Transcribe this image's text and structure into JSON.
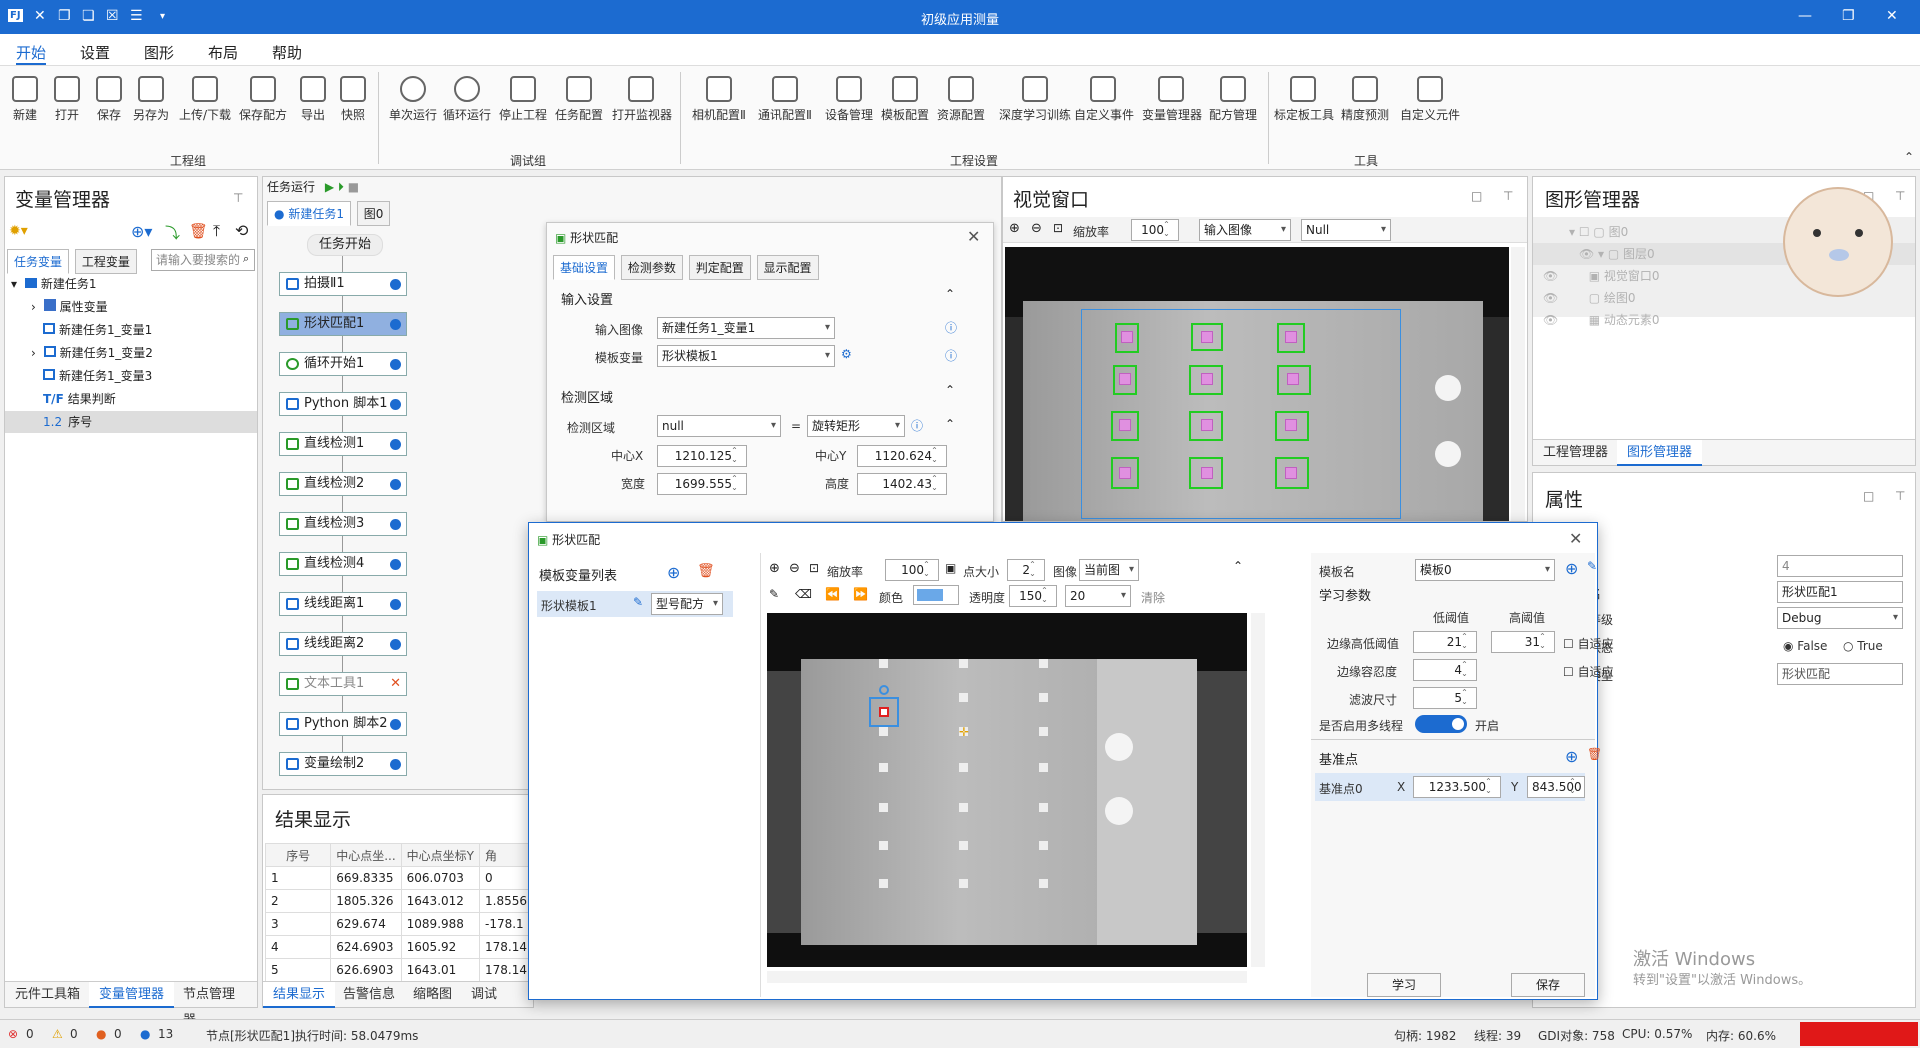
{
  "app": {
    "title": "初级应用测量",
    "quick_icons": [
      "app-logo-icon",
      "tool-icon",
      "copy-icon",
      "paste-icon",
      "checkbox-icon",
      "list-icon",
      "dropdown-icon"
    ]
  },
  "menu": [
    "开始",
    "设置",
    "图形",
    "布局",
    "帮助"
  ],
  "ribbon": {
    "buttons": [
      {
        "label": "新建",
        "icon": "new-file-icon"
      },
      {
        "label": "打开",
        "icon": "folder-open-icon"
      },
      {
        "label": "保存",
        "icon": "save-icon"
      },
      {
        "label": "另存为",
        "icon": "save-as-icon"
      },
      {
        "label": "上传/下载",
        "icon": "cloud-upload-icon"
      },
      {
        "label": "保存配方",
        "icon": "recipe-save-icon"
      },
      {
        "label": "导出",
        "icon": "export-icon"
      },
      {
        "label": "快照",
        "icon": "snapshot-icon"
      },
      {
        "label": "单次运行",
        "icon": "play-once-icon"
      },
      {
        "label": "循环运行",
        "icon": "loop-run-icon"
      },
      {
        "label": "停止工程",
        "icon": "stop-icon"
      },
      {
        "label": "任务配置",
        "icon": "task-config-icon"
      },
      {
        "label": "打开监视器",
        "icon": "monitor-icon"
      },
      {
        "label": "相机配置Ⅱ",
        "icon": "camera-icon"
      },
      {
        "label": "通讯配置Ⅱ",
        "icon": "network-icon"
      },
      {
        "label": "设备管理",
        "icon": "device-icon"
      },
      {
        "label": "模板配置",
        "icon": "template-icon"
      },
      {
        "label": "资源配置",
        "icon": "resource-icon"
      },
      {
        "label": "深度学习训练",
        "icon": "deep-learning-icon"
      },
      {
        "label": "自定义事件",
        "icon": "event-gear-icon"
      },
      {
        "label": "变量管理器",
        "icon": "fx-icon"
      },
      {
        "label": "配方管理",
        "icon": "recipe-grid-icon"
      },
      {
        "label": "标定板工具",
        "icon": "calibration-icon"
      },
      {
        "label": "精度预测",
        "icon": "precision-icon"
      },
      {
        "label": "自定义元件",
        "icon": "custom-component-icon"
      }
    ],
    "groups": [
      "工程组",
      "调试组",
      "工程设置",
      "工具"
    ]
  },
  "var_manager": {
    "title": "变量管理器",
    "tabs": [
      "任务变量",
      "工程变量"
    ],
    "search_placeholder": "请输入要搜索的",
    "tree": [
      "新建任务1",
      "属性变量",
      "新建任务1_变量1",
      "新建任务1_变量2",
      "新建任务1_变量3",
      "结果判断",
      "序号"
    ],
    "bottom_tabs": [
      "元件工具箱",
      "变量管理器",
      "节点管理器"
    ]
  },
  "flow": {
    "run_label": "任务运行",
    "tabs": [
      "新建任务1",
      "图0"
    ],
    "start": "任务开始",
    "nodes": [
      "拍摄Ⅱ1",
      "形状匹配1",
      "循环开始1",
      "Python 脚本1",
      "直线检测1",
      "直线检测2",
      "直线检测3",
      "直线检测4",
      "线线距离1",
      "线线距离2",
      "文本工具1",
      "Python 脚本2",
      "变量绘制2"
    ]
  },
  "results": {
    "title": "结果显示",
    "headers": [
      "序号",
      "中心点坐...",
      "中心点坐标Y",
      "角"
    ],
    "rows": [
      [
        "1",
        "669.8335",
        "606.0703",
        "0"
      ],
      [
        "2",
        "1805.326",
        "1643.012",
        "1.8556"
      ],
      [
        "3",
        "629.674",
        "1089.988",
        "-178.1"
      ],
      [
        "4",
        "624.6903",
        "1605.92",
        "178.14"
      ],
      [
        "5",
        "626.6903",
        "1643.01",
        "178.14"
      ]
    ],
    "bottom_tabs": [
      "结果显示",
      "告警信息",
      "缩略图",
      "调试"
    ]
  },
  "shape_cfg": {
    "title": "形状匹配",
    "tabs": [
      "基础设置",
      "检测参数",
      "判定配置",
      "显示配置"
    ],
    "input_section": "输入设置",
    "input_image_label": "输入图像",
    "input_image": "新建任务1_变量1",
    "template_var_label": "模板变量",
    "template_var": "形状模板1",
    "region_section": "检测区域",
    "region_label": "检测区域",
    "region_value": "null",
    "region_eq": "=",
    "region_shape": "旋转矩形",
    "cx_label": "中心X",
    "cx": "1210.125",
    "cy_label": "中心Y",
    "cy": "1120.624",
    "w_label": "宽度",
    "w": "1699.555",
    "h_label": "高度",
    "h": "1402.43"
  },
  "vision": {
    "title": "视觉窗口",
    "zoom_label": "缩放率",
    "zoom": "100",
    "source": "输入图像",
    "mode": "Null"
  },
  "graphic_manager": {
    "title": "图形管理器",
    "tree": [
      "图0",
      "图层0",
      "视觉窗口0",
      "绘图0",
      "动态元素0"
    ],
    "tabs": [
      "工程管理器",
      "图形管理器"
    ]
  },
  "properties": {
    "title": "属性",
    "name_label": "名",
    "level_label": "等级",
    "state_label": "状态",
    "type_label": "类型",
    "value_4": "4",
    "name": "形状匹配1",
    "level": "Debug",
    "false_label": "False",
    "true_label": "True",
    "type": "形状匹配"
  },
  "dialog": {
    "title": "形状匹配",
    "list_title": "模板变量列表",
    "template_item": "形状模板1",
    "template_recipe": "型号配方",
    "zoom_label": "缩放率",
    "zoom": "100",
    "point_label": "点大小",
    "point": "2",
    "image_label": "图像",
    "image": "当前图",
    "color_label": "颜色",
    "alpha_label": "透明度",
    "alpha": "150",
    "size": "20",
    "clear": "清除",
    "tpl_name_label": "模板名",
    "tpl_name": "模板0",
    "learn_section": "学习参数",
    "low_label": "低阈值",
    "high_label": "高阈值",
    "edge_label": "边缘高低阈值",
    "edge_low": "21",
    "edge_high": "31",
    "auto1": "自适应",
    "tol_label": "边缘容忍度",
    "tol": "4",
    "auto2": "自适应",
    "filter_label": "滤波尺寸",
    "filter": "5",
    "mt_label": "是否启用多线程",
    "mt_state": "开启",
    "base_section": "基准点",
    "base_name": "基准点0",
    "x_label": "X",
    "x": "1233.500",
    "y_label": "Y",
    "y": "843.500",
    "learn_btn": "学习",
    "save_btn": "保存"
  },
  "status": {
    "errors": "0",
    "warnings": "0",
    "info_orange": "0",
    "info_blue": "13",
    "message": "节点[形状匹配1]执行时间: 58.0479ms",
    "handles": "句柄: 1982",
    "threads": "线程: 39",
    "gdi": "GDI对象: 758",
    "cpu": "CPU: 0.57%",
    "mem": "内存: 60.6%"
  },
  "watermark": {
    "line1": "激活 Windows",
    "line2": "转到\"设置\"以激活 Windows。"
  },
  "colors": {
    "accent": "#1c6bd0",
    "selection": "#90b0e0",
    "green": "#22cc22",
    "magenta": "#e090e0"
  }
}
